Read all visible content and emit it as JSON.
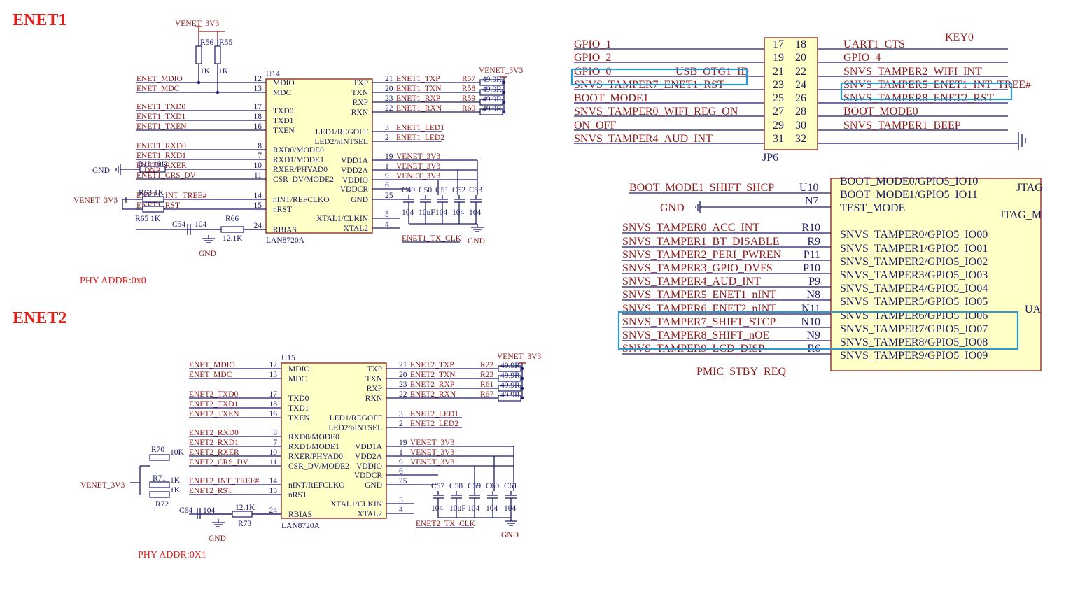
{
  "titles": {
    "enet1": "ENET1",
    "enet2": "ENET2"
  },
  "enet1": {
    "ref": "U14",
    "part": "LAN8720A",
    "phy_addr": "PHY ADDR:0x0",
    "left_pins": [
      {
        "net": "ENET_MDIO",
        "num": "12",
        "name": "MDIO"
      },
      {
        "net": "ENET_MDC",
        "num": "13",
        "name": "MDC"
      },
      {
        "net": "ENET1_TXD0",
        "num": "17",
        "name": "TXD0"
      },
      {
        "net": "ENET1_TXD1",
        "num": "18",
        "name": "TXD1"
      },
      {
        "net": "ENET1_TXEN",
        "num": "16",
        "name": "TXEN"
      },
      {
        "net": "ENET1_RXD0",
        "num": "8",
        "name": "RXD0/MODE0"
      },
      {
        "net": "ENET1_RXD1",
        "num": "7",
        "name": "RXD1/MODE1"
      },
      {
        "net": "ENET1_RXER",
        "num": "10",
        "name": "RXER/PHYAD0"
      },
      {
        "net": "ENET1_CRS_DV",
        "num": "11",
        "name": "CSR_DV/MODE2"
      },
      {
        "net": "ENET1_INT_TREE#",
        "num": "14",
        "name": "nINT/REFCLKO"
      },
      {
        "net": "ENET1_RST",
        "num": "15",
        "name": "nRST"
      },
      {
        "net": "",
        "num": "24",
        "name": "RBIAS"
      }
    ],
    "right_pins": [
      {
        "name": "TXP",
        "num": "21",
        "net": "ENET1_TXP",
        "res": "R57",
        "val": "49.9R"
      },
      {
        "name": "TXN",
        "num": "20",
        "net": "ENET1_TXN",
        "res": "R58",
        "val": "49.9R"
      },
      {
        "name": "RXP",
        "num": "23",
        "net": "ENET1_RXP",
        "res": "R59",
        "val": "49.9R"
      },
      {
        "name": "RXN",
        "num": "22",
        "net": "ENET1_RXN",
        "res": "R60",
        "val": "49.9R"
      },
      {
        "name": "LED1/REGOFF",
        "num": "3",
        "net": "ENET1_LED1"
      },
      {
        "name": "LED2/nINTSEL",
        "num": "2",
        "net": "ENET1_LED2"
      },
      {
        "name": "VDD1A",
        "num": "19",
        "net": "VENET_3V3"
      },
      {
        "name": "VDD2A",
        "num": "1",
        "net": "VENET_3V3"
      },
      {
        "name": "VDDIO",
        "num": "9",
        "net": "VENET_3V3"
      },
      {
        "name": "VDDCR",
        "num": "6",
        "net": ""
      },
      {
        "name": "GND",
        "num": "25",
        "net": ""
      },
      {
        "name": "XTAL1/CLKIN",
        "num": "5",
        "net": "ENET1_TX_CLK"
      },
      {
        "name": "XTAL2",
        "num": "4",
        "net": ""
      }
    ],
    "pullups": {
      "r56": "R56",
      "r55": "R55",
      "r56v": "1K",
      "r55v": "1K",
      "rail": "VENET_3V3"
    },
    "rail_right": "VENET_3V3",
    "caps": [
      "C49",
      "C50",
      "C51",
      "C52",
      "C53"
    ],
    "cap_vals": [
      "104",
      "10uF",
      "104",
      "104",
      "104"
    ],
    "gnd": "GND",
    "r13": "R13",
    "r13v": "10K",
    "dnp": "DNP",
    "r63": "R63",
    "r63v": "1K",
    "r65": "R65",
    "r65v": "1K",
    "c54": "C54",
    "c54v": "104",
    "r66": "R66",
    "r66v": "12.1K",
    "left_rail": "VENET_3V3"
  },
  "enet2": {
    "ref": "U15",
    "part": "LAN8720A",
    "phy_addr": "PHY ADDR:0X1",
    "left_pins": [
      {
        "net": "ENET_MDIO",
        "num": "12",
        "name": "MDIO"
      },
      {
        "net": "ENET_MDC",
        "num": "13",
        "name": "MDC"
      },
      {
        "net": "ENET2_TXD0",
        "num": "17",
        "name": "TXD0"
      },
      {
        "net": "ENET2_TXD1",
        "num": "18",
        "name": "TXD1"
      },
      {
        "net": "ENET2_TXEN",
        "num": "16",
        "name": "TXEN"
      },
      {
        "net": "ENET2_RXD0",
        "num": "8",
        "name": "RXD0/MODE0"
      },
      {
        "net": "ENET2_RXD1",
        "num": "7",
        "name": "RXD1/MODE1"
      },
      {
        "net": "ENET2_RXER",
        "num": "10",
        "name": "RXER/PHYAD0"
      },
      {
        "net": "ENET2_CRS_DV",
        "num": "11",
        "name": "CSR_DV/MODE2"
      },
      {
        "net": "ENET2_INT_TREE#",
        "num": "14",
        "name": "nINT/REFCLKO"
      },
      {
        "net": "ENET2_RST",
        "num": "15",
        "name": "nRST"
      },
      {
        "net": "",
        "num": "24",
        "name": "RBIAS"
      }
    ],
    "right_pins": [
      {
        "name": "TXP",
        "num": "21",
        "net": "ENET2_TXP",
        "res": "R22",
        "val": "49.9R"
      },
      {
        "name": "TXN",
        "num": "20",
        "net": "ENET2_TXN",
        "res": "R23",
        "val": "49.9R"
      },
      {
        "name": "RXP",
        "num": "23",
        "net": "ENET2_RXP",
        "res": "R61",
        "val": "49.9R"
      },
      {
        "name": "RXN",
        "num": "22",
        "net": "ENET2_RXN",
        "res": "R67",
        "val": "49.9R"
      },
      {
        "name": "LED1/REGOFF",
        "num": "3",
        "net": "ENET2_LED1"
      },
      {
        "name": "LED2/nINTSEL",
        "num": "2",
        "net": "ENET2_LED2"
      },
      {
        "name": "VDD1A",
        "num": "19",
        "net": "VENET_3V3"
      },
      {
        "name": "VDD2A",
        "num": "1",
        "net": "VENET_3V3"
      },
      {
        "name": "VDDIO",
        "num": "9",
        "net": "VENET_3V3"
      },
      {
        "name": "VDDCR",
        "num": "6",
        "net": ""
      },
      {
        "name": "GND",
        "num": "25",
        "net": ""
      },
      {
        "name": "XTAL1/CLKIN",
        "num": "5",
        "net": "ENET2_TX_CLK"
      },
      {
        "name": "XTAL2",
        "num": "4",
        "net": ""
      }
    ],
    "rail_right": "VENET_3V3",
    "caps": [
      "C57",
      "C58",
      "C59",
      "C60",
      "C61"
    ],
    "cap_vals": [
      "104",
      "10uF",
      "104",
      "104",
      "104"
    ],
    "gnd": "GND",
    "r70": "R70",
    "r70v": "10K",
    "r71": "R71",
    "r71v": "1K",
    "r72": "R72",
    "r72v": "1K",
    "c64": "C64",
    "c64v": "104",
    "r73": "R73",
    "r73v": "12.1K",
    "left_rail": "VENET_3V3"
  },
  "jp6": {
    "ref": "JP6",
    "rows": [
      {
        "l": "GPIO_1",
        "a": "17",
        "b": "18",
        "r": "UART1_CTS"
      },
      {
        "l": "GPIO_2",
        "a": "19",
        "b": "20",
        "r": "GPIO_4"
      },
      {
        "l": "GPIO_0",
        "l2": "USB_OTG1_ID",
        "a": "21",
        "b": "22",
        "r": "SNVS_TAMPER2_WIFI_INT"
      },
      {
        "l": "SNVS_TAMPER7_ENET1_RST",
        "a": "23",
        "b": "24",
        "r": "SNVS_TAMPER5_ENET1_INT_TREE#"
      },
      {
        "l": "BOOT_MODE1",
        "a": "25",
        "b": "26",
        "r": "SNVS_TAMPER8_ENET2_RST"
      },
      {
        "l": "SNVS_TAMPER0_WIFI_REG_ON",
        "a": "27",
        "b": "28",
        "r": "BOOT_MODE0"
      },
      {
        "l": "ON_OFF",
        "a": "29",
        "b": "30",
        "r": "SNVS_TAMPER1_BEEP"
      },
      {
        "l": "SNVS_TAMPER4_AUD_INT",
        "a": "31",
        "b": "32",
        "r": ""
      }
    ],
    "top_right_extra": "KEY0"
  },
  "mcu": {
    "top_left": [
      {
        "net": "BOOT_MODE1_SHIFT_SHCP",
        "ball": "U10",
        "fn": "BOOT_MODE1/GPIO5_IO11"
      },
      {
        "net": "GND",
        "ball": "N7",
        "fn": "TEST_MODE"
      }
    ],
    "top_fn0": "BOOT_MODE0/GPIO5_IO10",
    "rows": [
      {
        "net": "SNVS_TAMPER0_ACC_INT",
        "ball": "R10",
        "fn": "SNVS_TAMPER0/GPIO5_IO00"
      },
      {
        "net": "SNVS_TAMPER1_BT_DISABLE",
        "ball": "R9",
        "fn": "SNVS_TAMPER1/GPIO5_IO01"
      },
      {
        "net": "SNVS_TAMPER2_PERI_PWREN",
        "ball": "P11",
        "fn": "SNVS_TAMPER2/GPIO5_IO02"
      },
      {
        "net": "SNVS_TAMPER3_GPIO_DVFS",
        "ball": "P10",
        "fn": "SNVS_TAMPER3/GPIO5_IO03"
      },
      {
        "net": "SNVS_TAMPER4_AUD_INT",
        "ball": "P9",
        "fn": "SNVS_TAMPER4/GPIO5_IO04"
      },
      {
        "net": "SNVS_TAMPER5_ENET1_nINT",
        "ball": "N8",
        "fn": "SNVS_TAMPER5/GPIO5_IO05"
      },
      {
        "net": "SNVS_TAMPER6_ENET2_nINT",
        "ball": "N11",
        "fn": "SNVS_TAMPER6/GPIO5_IO06"
      },
      {
        "net": "SNVS_TAMPER7_SHIFT_STCP",
        "ball": "N10",
        "fn": "SNVS_TAMPER7/GPIO5_IO07"
      },
      {
        "net": "SNVS_TAMPER8_SHIFT_nOE",
        "ball": "N9",
        "fn": "SNVS_TAMPER8/GPIO5_IO08"
      },
      {
        "net": "SNVS_TAMPER9_LCD_DISP",
        "ball": "R6",
        "fn": "SNVS_TAMPER9/GPIO5_IO09"
      }
    ],
    "side_labels": [
      "JTAG",
      "JTAG_M",
      "UA"
    ],
    "bottom_clip": "PMIC_STBY_REQ"
  },
  "colors": {
    "net": "#8b1a1a",
    "pin": "#1b1b6a",
    "chip": "#ffffc8",
    "highlight": "#2b9ad4",
    "title": "#e0201c"
  }
}
